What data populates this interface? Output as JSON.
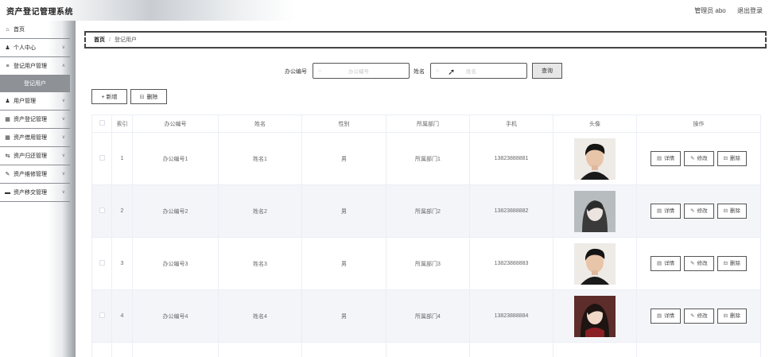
{
  "app": {
    "title": "资产登记管理系统"
  },
  "header": {
    "user_label": "管理员 abo",
    "logout_label": "退出登录"
  },
  "sidebar": {
    "items": [
      {
        "label": "首页",
        "icon": "home-icon",
        "glyph": "⌂",
        "has_chevron": false
      },
      {
        "label": "个人中心",
        "icon": "user-icon",
        "glyph": "♟",
        "has_chevron": true
      },
      {
        "label": "登记用户管理",
        "icon": "list-icon",
        "glyph": "≡",
        "has_chevron": true
      },
      {
        "label": "用户管理",
        "icon": "user-icon",
        "glyph": "♟",
        "has_chevron": true
      },
      {
        "label": "资产登记管理",
        "icon": "grid-icon",
        "glyph": "▦",
        "has_chevron": true
      },
      {
        "label": "资产借用管理",
        "icon": "grid-icon",
        "glyph": "▦",
        "has_chevron": true
      },
      {
        "label": "资产归还管理",
        "icon": "return-icon",
        "glyph": "⇆",
        "has_chevron": true
      },
      {
        "label": "资产维修管理",
        "icon": "repair-icon",
        "glyph": "✎",
        "has_chevron": true
      },
      {
        "label": "资产移交管理",
        "icon": "transfer-icon",
        "glyph": "▬",
        "has_chevron": true
      }
    ],
    "active_sub": "登记用户"
  },
  "breadcrumb": {
    "home": "首页",
    "separator": "/",
    "current": "登记用户"
  },
  "search": {
    "office_label": "办公编号",
    "office_placeholder": "办公编号",
    "name_label": "姓名",
    "name_placeholder": "姓名",
    "query_label": "查询"
  },
  "toolbar": {
    "add_label": "+ 新增",
    "delete_label": "删除"
  },
  "table": {
    "columns": [
      "",
      "索引",
      "办公编号",
      "姓名",
      "性别",
      "所属部门",
      "手机",
      "头像",
      "操作"
    ],
    "actions": {
      "detail": "详情",
      "edit": "修改",
      "delete": "删除"
    },
    "rows": [
      {
        "index": "1",
        "office_no": "办公编号1",
        "name": "姓名1",
        "gender": "男",
        "dept": "所属部门1",
        "phone": "13823888881",
        "avatar": "male"
      },
      {
        "index": "2",
        "office_no": "办公编号2",
        "name": "姓名2",
        "gender": "男",
        "dept": "所属部门2",
        "phone": "13823888882",
        "avatar": "female-gray"
      },
      {
        "index": "3",
        "office_no": "办公编号3",
        "name": "姓名3",
        "gender": "男",
        "dept": "所属部门3",
        "phone": "13823888883",
        "avatar": "male"
      },
      {
        "index": "4",
        "office_no": "办公编号4",
        "name": "姓名4",
        "gender": "男",
        "dept": "所属部门4",
        "phone": "13823888884",
        "avatar": "female-red"
      }
    ]
  }
}
